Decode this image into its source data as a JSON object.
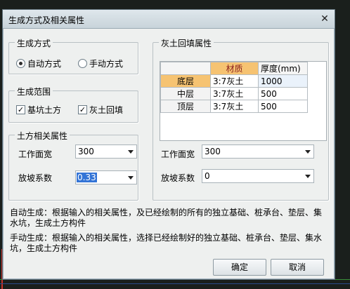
{
  "dialog": {
    "title": "生成方式及相关属性",
    "close_glyph": "✕"
  },
  "gen_mode": {
    "legend": "生成方式",
    "auto": "自动方式",
    "manual": "手动方式",
    "selected": "auto"
  },
  "gen_scope": {
    "legend": "生成范围",
    "pit": "基坑土方",
    "backfill": "灰土回填"
  },
  "earth_props": {
    "legend": "土方相关属性",
    "work_width_label": "工作面宽",
    "work_width_value": "300",
    "slope_label": "放坡系数",
    "slope_value": "0.33"
  },
  "backfill_props": {
    "legend": "灰土回填属性",
    "header_material": "材质",
    "header_thickness": "厚度(mm)",
    "rows": [
      {
        "layer": "底层",
        "material": "3:7灰土",
        "thickness": "1000"
      },
      {
        "layer": "中层",
        "material": "3:7灰土",
        "thickness": "500"
      },
      {
        "layer": "顶层",
        "material": "3:7灰土",
        "thickness": "500"
      }
    ],
    "work_width_label": "工作面宽",
    "work_width_value": "300",
    "slope_label": "放坡系数",
    "slope_value": "0"
  },
  "descriptions": {
    "auto": "自动生成：根据输入的相关属性，及已经绘制的所有的独立基础、桩承台、垫层、集水坑，生成土方构件",
    "manual": "手动生成：根据输入的相关属性，选择已经绘制好的独立基础、桩承台、垫层、集水坑，生成土方构件"
  },
  "buttons": {
    "ok": "确定",
    "cancel": "取消"
  }
}
